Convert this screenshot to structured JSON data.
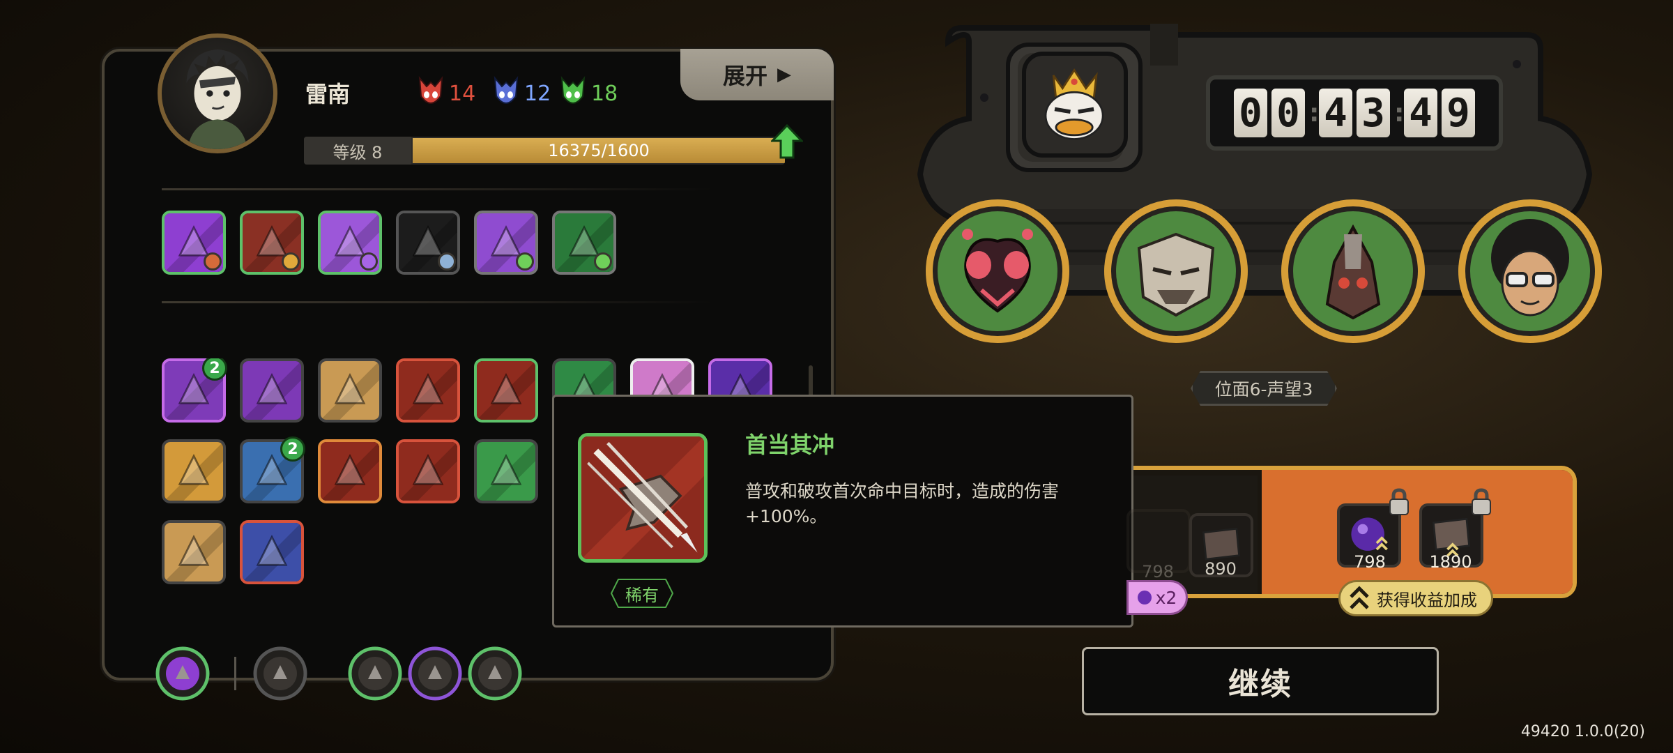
{
  "character": {
    "name": "雷南",
    "stats": [
      {
        "icon": "red-mask-icon",
        "value": "14",
        "color": "#e0503e"
      },
      {
        "icon": "blue-mask-icon",
        "value": "12",
        "color": "#7fa6ff"
      },
      {
        "icon": "green-mask-icon",
        "value": "18",
        "color": "#6fcf5a"
      }
    ],
    "expand_label": "展开",
    "level_label": "等级 8",
    "exp_text": "16375/1600",
    "exp_fraction": 1.0
  },
  "equipment_slots": [
    {
      "name": "purple-hand-gear",
      "border": "#5ec16a",
      "bg": "#8e3fd1",
      "gem": "#d46b3a"
    },
    {
      "name": "ring-gear",
      "border": "#5ec16a",
      "bg": "#8a3024",
      "gem": "#e0a93b"
    },
    {
      "name": "bubble-gear",
      "border": "#5ec16a",
      "bg": "#9c57d9",
      "gem": "#a765e6"
    },
    {
      "name": "empty-slot",
      "border": "#555",
      "bg": "#1c1c1c",
      "gem": "#8fb2d6"
    },
    {
      "name": "box-gear",
      "border": "#777",
      "bg": "#8f4cd0",
      "gem": "#6fcf5a"
    },
    {
      "name": "leaf-gear",
      "border": "#777",
      "bg": "#2a7a3a",
      "gem": "#6fcf5a"
    }
  ],
  "skills": [
    {
      "name": "tower-skill",
      "border": "#c56be8",
      "bg": "#7e3bb8",
      "badge": "2"
    },
    {
      "name": "shield-heart-skill",
      "border": "#444",
      "bg": "#7d39b6",
      "badge": ""
    },
    {
      "name": "sunrise-skill",
      "border": "#444",
      "bg": "#c99a54",
      "badge": ""
    },
    {
      "name": "hammers-skill",
      "border": "#d8533c",
      "bg": "#8f2b1e",
      "badge": ""
    },
    {
      "name": "slash-red-skill",
      "border": "#5ec16a",
      "bg": "#8f2b1e",
      "badge": ""
    },
    {
      "name": "green-diamond-skill",
      "border": "#444",
      "bg": "#2f8a45",
      "badge": ""
    },
    {
      "name": "pink-feather-skill",
      "border": "#eee",
      "bg": "#cf7ac9",
      "badge": ""
    },
    {
      "name": "purple-beast-skill",
      "border": "#c56be8",
      "bg": "#5a2ea8",
      "badge": ""
    },
    {
      "name": "explosion-skill",
      "border": "#444",
      "bg": "#d39a3a",
      "badge": ""
    },
    {
      "name": "dragon-skill",
      "border": "#444",
      "bg": "#3a6fb0",
      "badge": "2"
    },
    {
      "name": "tooth-skill",
      "border": "#e08a3a",
      "bg": "#8f2b1e",
      "badge": ""
    },
    {
      "name": "green-spear-skill",
      "border": "#d8533c",
      "bg": "#8f2b1e",
      "badge": ""
    },
    {
      "name": "green-shield-skill",
      "border": "#444",
      "bg": "#3a9a4a",
      "badge": ""
    },
    {
      "name": "rays-skill",
      "border": "#444",
      "bg": "#8f2b1e",
      "badge": ""
    },
    {
      "name": "purple-claw-skill",
      "border": "#5ec16a",
      "bg": "#7e3bb8",
      "badge": ""
    },
    {
      "name": "fire-demon-skill",
      "border": "#444",
      "bg": "#c0481e",
      "badge": ""
    },
    {
      "name": "chain-skill",
      "border": "#444",
      "bg": "#c99a54",
      "badge": ""
    },
    {
      "name": "masked-face-skill",
      "border": "#d8533c",
      "bg": "#3d4fa8",
      "badge": ""
    }
  ],
  "bottom_slots": [
    {
      "name": "purple-flame-slot",
      "ring": "#5ec16a",
      "fill": "#8e3fd1"
    },
    {
      "name": "red-claw-slot",
      "ring": "#555",
      "fill": "#3a3632"
    },
    {
      "name": "triangle-rune-slot",
      "ring": "#5ec16a",
      "fill": "#3a3632"
    },
    {
      "name": "heart-rune-slot",
      "ring": "#8e55d8",
      "fill": "#3a3632"
    },
    {
      "name": "green-arrows-slot",
      "ring": "#5ec16a",
      "fill": "#3a3632"
    }
  ],
  "tooltip": {
    "title": "首当其冲",
    "description": "普攻和破攻首次命中目标时，造成的伤害+100%。",
    "rarity": "稀有"
  },
  "timer": {
    "digits": [
      "0",
      "0",
      "4",
      "3",
      "4",
      "9"
    ]
  },
  "enemies": [
    {
      "name": "fly-enemy"
    },
    {
      "name": "armored-beast-enemy"
    },
    {
      "name": "bird-mech-enemy"
    },
    {
      "name": "afro-boy-enemy"
    }
  ],
  "position_label": "位面6-声望3",
  "rewards": {
    "x2_label": "x2",
    "ghost_items": [
      {
        "count": "798"
      },
      {
        "count": "890"
      }
    ],
    "items": [
      {
        "name": "purple-orb-reward",
        "count": "798"
      },
      {
        "name": "book-reward",
        "count": "1890"
      }
    ],
    "bonus_label": "获得收益加成"
  },
  "continue_label": "继续",
  "version": "49420 1.0.0(20)"
}
